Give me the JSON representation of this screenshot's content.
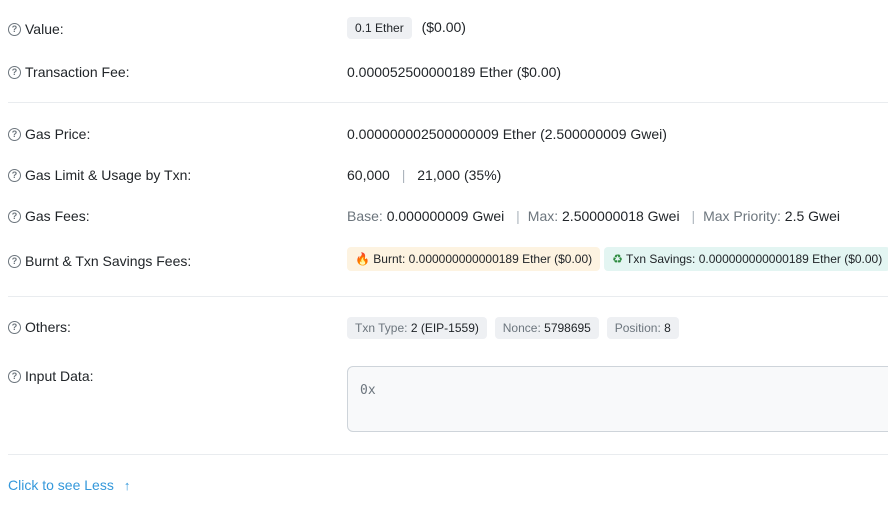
{
  "value": {
    "label": "Value:",
    "amount": "0.1 Ether",
    "usd": "($0.00)"
  },
  "fee": {
    "label": "Transaction Fee:",
    "text": "0.000052500000189 Ether ($0.00)"
  },
  "gas_price": {
    "label": "Gas Price:",
    "text": "0.000000002500000009 Ether (2.500000009 Gwei)"
  },
  "gas_limit": {
    "label": "Gas Limit & Usage by Txn:",
    "limit": "60,000",
    "usage": "21,000 (35%)"
  },
  "gas_fees": {
    "label": "Gas Fees:",
    "base_k": "Base:",
    "base_v": "0.000000009 Gwei",
    "max_k": "Max:",
    "max_v": "2.500000018 Gwei",
    "prio_k": "Max Priority:",
    "prio_v": "2.5 Gwei"
  },
  "burnt": {
    "label": "Burnt & Txn Savings Fees:",
    "burnt_text": "Burnt: 0.000000000000189 Ether ($0.00)",
    "savings_text": "Txn Savings: 0.000000000000189 Ether ($0.00)"
  },
  "others": {
    "label": "Others:",
    "txn_type_k": "Txn Type:",
    "txn_type_v": "2 (EIP-1559)",
    "nonce_k": "Nonce:",
    "nonce_v": "5798695",
    "position_k": "Position:",
    "position_v": "8"
  },
  "input": {
    "label": "Input Data:",
    "value": "0x"
  },
  "toggle_link": "Click to see Less",
  "colors": {
    "link": "#3498db",
    "burnt_bg": "#fdf3e1",
    "savings_bg": "#e3f5f2"
  }
}
